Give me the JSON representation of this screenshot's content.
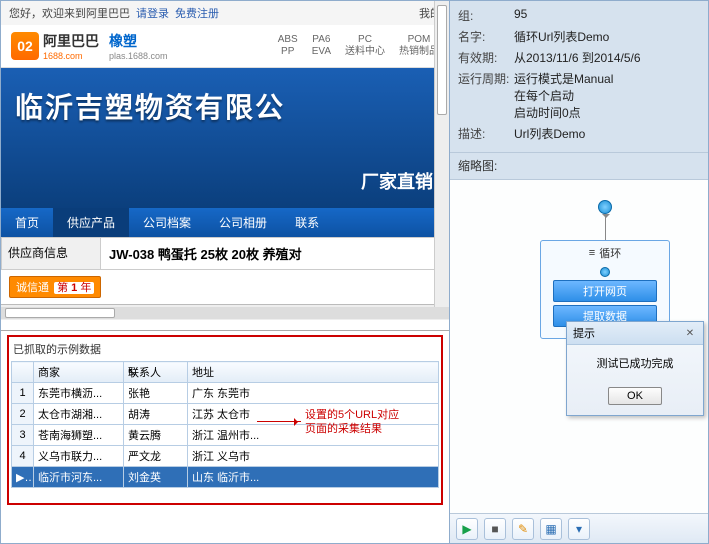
{
  "topbar": {
    "greet": "您好，欢迎来到阿里巴巴",
    "login": "请登录",
    "register": "免费注册",
    "right": "我的"
  },
  "site": {
    "logo_text": "阿里巴巴",
    "logo_sub": "1688.com",
    "cat": "橡塑",
    "cat_sub": "plas.1688.com",
    "tabs": [
      {
        "a": "ABS",
        "b": "PP"
      },
      {
        "a": "PA6",
        "b": "EVA"
      },
      {
        "a": "PC",
        "b": "送料中心"
      },
      {
        "a": "POM",
        "b": "热销制品"
      }
    ]
  },
  "hero": {
    "title": "临沂吉塑物资有限公",
    "sub": "厂家直销"
  },
  "nav": {
    "items": [
      "首页",
      "供应产品",
      "公司档案",
      "公司相册",
      "联系"
    ],
    "active_index": 1
  },
  "supplier": {
    "label": "供应商信息",
    "strip": "JW-038 鸭蛋托  25枚  20枚  养殖对"
  },
  "badge": {
    "text": "诚信通",
    "year_label": "第",
    "year": "1",
    "year_suffix": "年"
  },
  "grid": {
    "title": "已抓取的示例数据",
    "columns": [
      "商家",
      "联系人",
      "地址"
    ],
    "rows": [
      {
        "n": "1",
        "a": "东莞市横沥...",
        "b": "张艳",
        "c": "广东 东莞市"
      },
      {
        "n": "2",
        "a": "太仓市湖湘...",
        "b": "胡涛",
        "c": "江苏 太仓市"
      },
      {
        "n": "3",
        "a": "苍南海狮塑...",
        "b": "黄云腾",
        "c": "浙江 温州市..."
      },
      {
        "n": "4",
        "a": "义乌市联力...",
        "b": "严文龙",
        "c": "浙江 义乌市"
      },
      {
        "n": "5",
        "a": "临沂市河东...",
        "b": "刘金英",
        "c": "山东 临沂市..."
      }
    ],
    "selected_index": 4
  },
  "annotation": {
    "line1": "设置的5个URL对应",
    "line2": "页面的采集结果"
  },
  "info": {
    "group_k": "组:",
    "group_v": "95",
    "name_k": "名字:",
    "name_v": "循环Url列表Demo",
    "valid_k": "有效期:",
    "valid_v": "从2013/11/6 到2014/5/6",
    "cycle_k": "运行周期:",
    "cycle_v1": "运行模式是Manual",
    "cycle_v2": "在每个启动",
    "cycle_v3": "启动时间0点",
    "desc_k": "描述:",
    "desc_v": "Url列表Demo",
    "thumb_label": "缩略图:"
  },
  "flow": {
    "loop_title": "循环",
    "step1": "打开网页",
    "step2": "提取数据"
  },
  "modal": {
    "title": "提示",
    "body": "测试已成功完成",
    "ok": "OK"
  },
  "toolbar_icons": {
    "play": "▶",
    "stop": "■",
    "edit": "✎",
    "grid": "▦",
    "more": "▾"
  }
}
